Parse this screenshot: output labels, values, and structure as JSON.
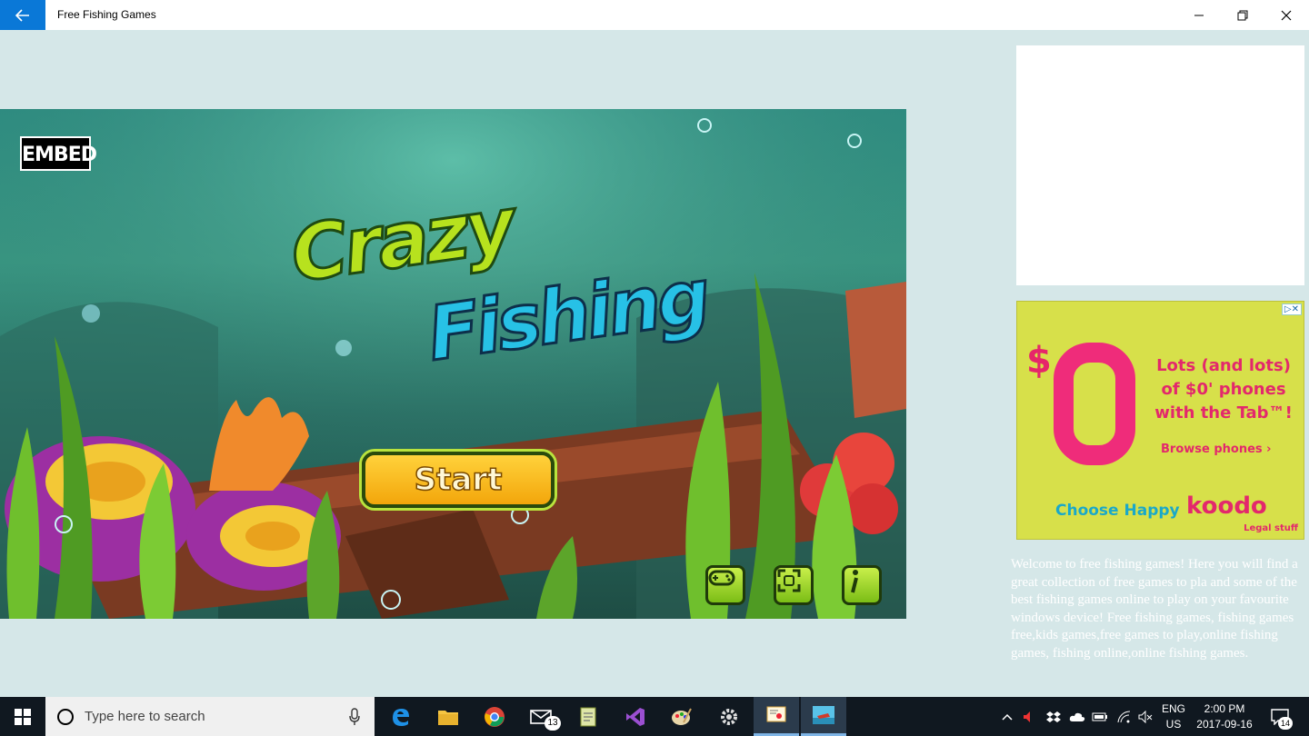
{
  "window": {
    "title": "Free Fishing Games",
    "controls": [
      "minimize",
      "restore",
      "close"
    ]
  },
  "game": {
    "embed_label": "EMBED",
    "logo_line1": "Crazy",
    "logo_line2": "Fishing",
    "start_label": "Start",
    "buttons": [
      "gamepad-icon",
      "fullscreen-icon",
      "info-icon"
    ]
  },
  "ad": {
    "dollar": "$",
    "headline": "Lots (and lots) of $0' phones with the Tab™!",
    "cta": "Browse phones ›",
    "tagline": "Choose Happy",
    "brand": "koodo",
    "legal": "Legal stuff",
    "adchoices": "▷✕"
  },
  "welcome_text": "Welcome to free fishing games! Here you will find a great collection of free games to pla and some of the best fishing games online to play on your favourite windows device! Free fishing games, fishing games free,kids games,free games to play,online fishing games, fishing online,online fishing games.",
  "taskbar": {
    "search_placeholder": "Type here to search",
    "mail_badge": "13",
    "lang_line1": "ENG",
    "lang_line2": "US",
    "time": "2:00 PM",
    "date": "2017-09-16",
    "notification_count": "14"
  },
  "colors": {
    "accent": "#0a78d7",
    "background": "#d5e7e8",
    "taskbar": "#101820"
  }
}
